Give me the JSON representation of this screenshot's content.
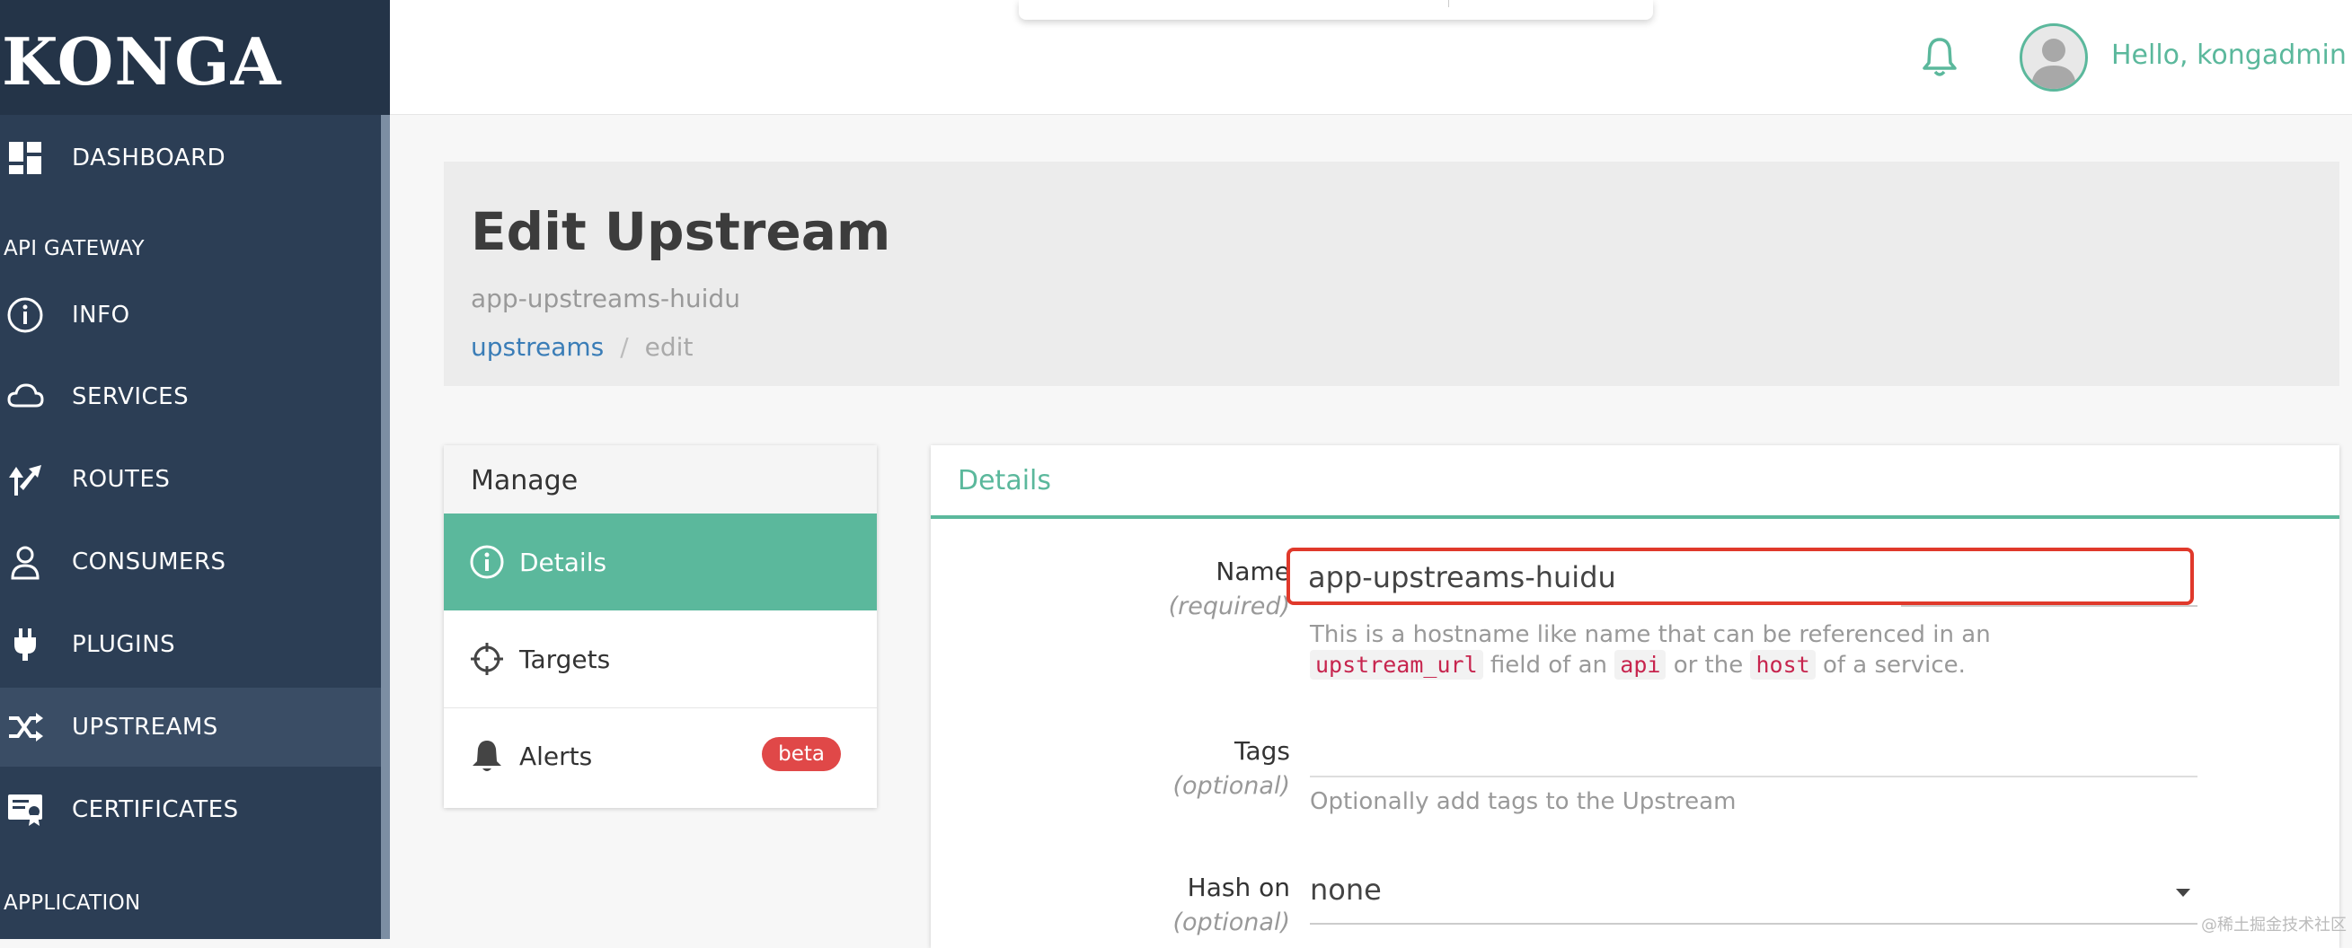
{
  "app": {
    "brand": "KONGA"
  },
  "topbar": {
    "greeting": "Hello, kongadmin"
  },
  "sidebar": {
    "dashboard": "DASHBOARD",
    "section_api_gateway": "API GATEWAY",
    "items": [
      {
        "label": "INFO",
        "icon": "info-icon"
      },
      {
        "label": "SERVICES",
        "icon": "cloud-icon"
      },
      {
        "label": "ROUTES",
        "icon": "routes-icon"
      },
      {
        "label": "CONSUMERS",
        "icon": "user-icon"
      },
      {
        "label": "PLUGINS",
        "icon": "plug-icon"
      },
      {
        "label": "UPSTREAMS",
        "icon": "shuffle-icon",
        "active": true
      },
      {
        "label": "CERTIFICATES",
        "icon": "certificate-icon"
      }
    ],
    "section_application": "APPLICATION"
  },
  "header": {
    "title": "Edit Upstream",
    "subtitle": "app-upstreams-huidu",
    "breadcrumb": {
      "link": "upstreams",
      "separator": "/",
      "current": "edit"
    }
  },
  "manage": {
    "title": "Manage",
    "items": [
      {
        "label": "Details",
        "icon": "info-icon",
        "active": true
      },
      {
        "label": "Targets",
        "icon": "crosshair-icon"
      },
      {
        "label": "Alerts",
        "icon": "bell-icon",
        "badge": "beta"
      }
    ]
  },
  "details": {
    "title": "Details",
    "name": {
      "label": "Name",
      "hint": "(required)",
      "value": "app-upstreams-huidu",
      "help_line1": "This is a hostname like name that can be referenced in an",
      "help_code1": "upstream_url",
      "help_text2": "field of an",
      "help_code2": "api",
      "help_text3": "or the",
      "help_code3": "host",
      "help_text4": "of a service."
    },
    "tags": {
      "label": "Tags",
      "hint": "(optional)",
      "help": "Optionally add tags to the Upstream"
    },
    "hash_on": {
      "label": "Hash on",
      "hint": "(optional)",
      "value": "none"
    }
  },
  "watermark": "@稀土掘金技术社区",
  "colors": {
    "accent": "#5bb89c",
    "sidebar": "#2c3e55",
    "highlight": "#e0392b",
    "badge": "#e04848"
  }
}
